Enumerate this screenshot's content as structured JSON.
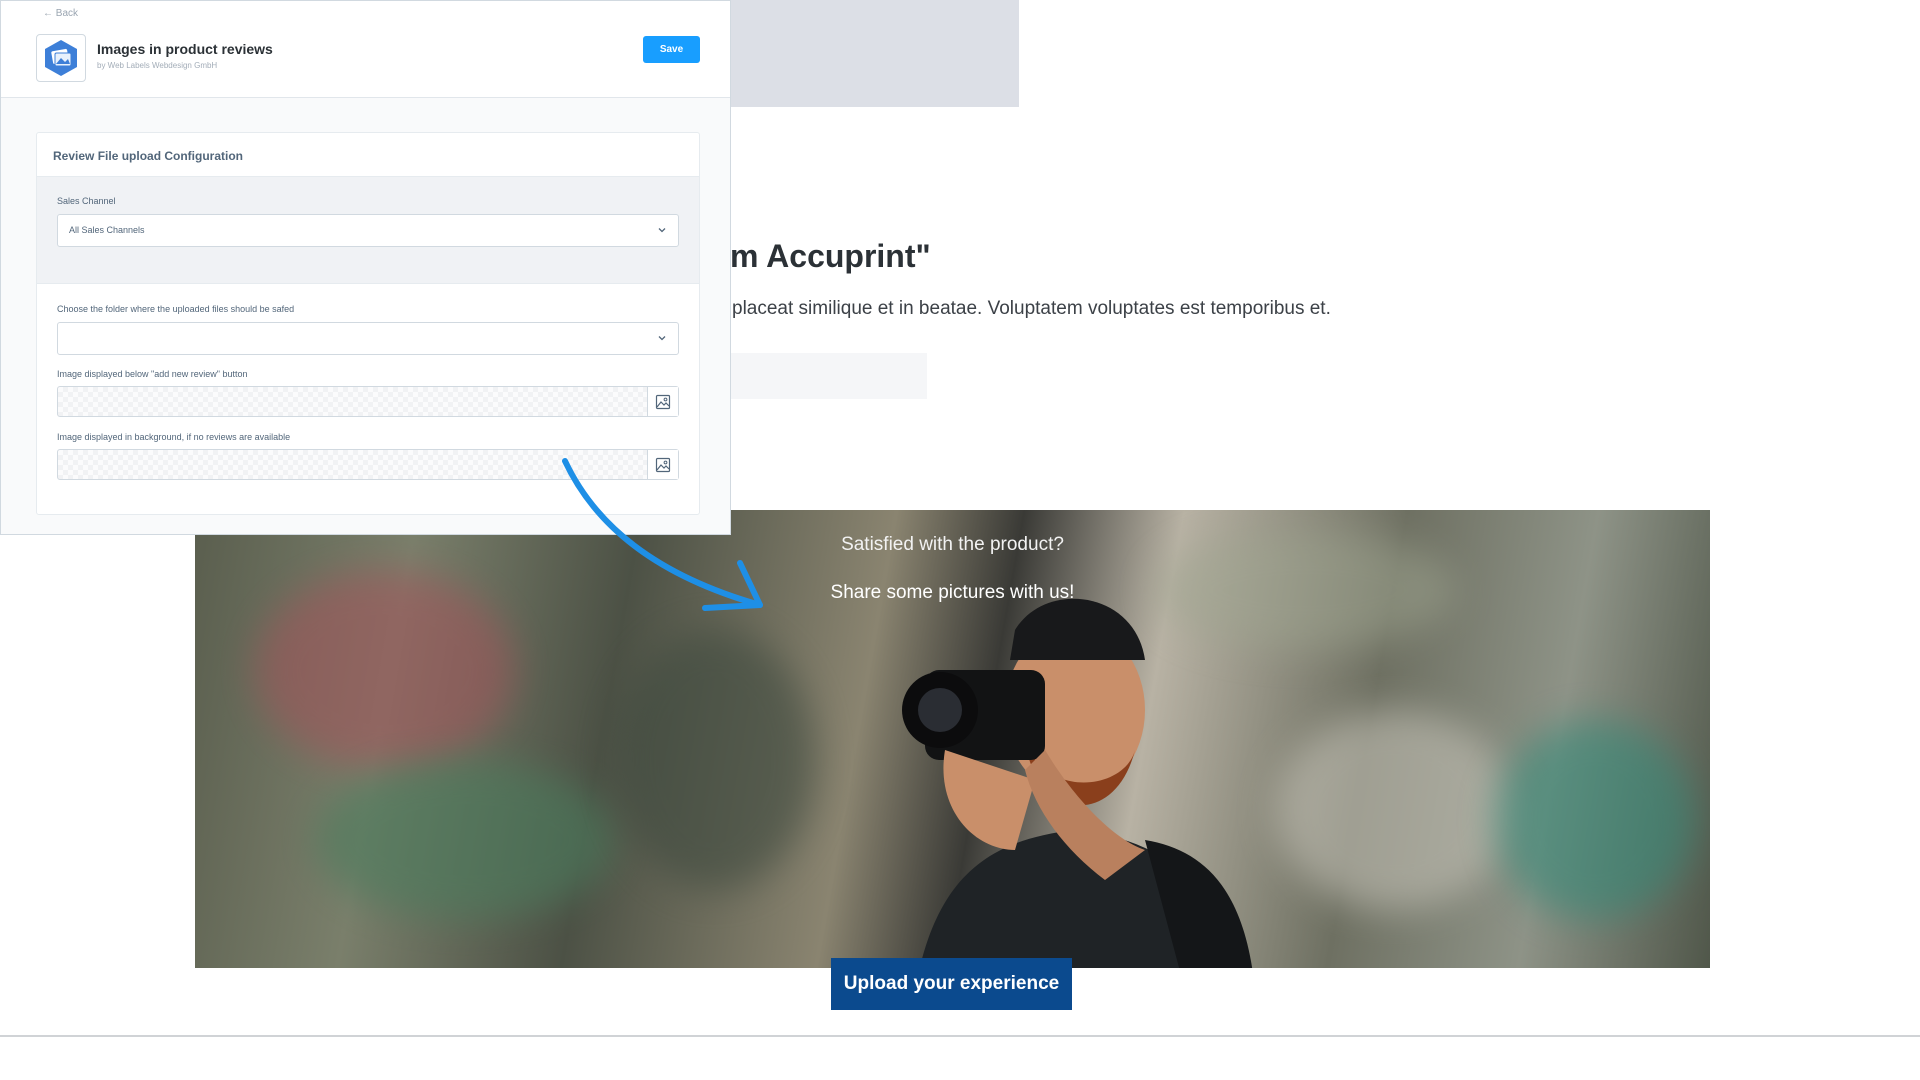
{
  "storefront": {
    "product_title": "m Accuprint\"",
    "product_description": "placeat similique et in beatae. Voluptatem voluptates est temporibus et.",
    "hero": {
      "line1": "Satisfied with the product?",
      "line2": "Share some pictures with us!",
      "upload_label": "Upload your experience"
    }
  },
  "admin": {
    "back_label": "← Back",
    "app_title": "Images in product reviews",
    "app_vendor": "by Web Labels Webdesign GmbH",
    "save_label": "Save",
    "card_title": "Review File upload Configuration",
    "sales_channel": {
      "label": "Sales Channel",
      "value": "All Sales Channels"
    },
    "folder": {
      "label": "Choose the folder where the uploaded files should be safed",
      "value": ""
    },
    "image_below_button": {
      "label": "Image displayed below \"add new review\" button"
    },
    "image_background": {
      "label": "Image displayed in background, if no reviews are available"
    }
  },
  "icons": {
    "app_logo": "images-app-icon",
    "chevron": "chevron-down-icon",
    "media": "image-icon",
    "arrow": "curved-arrow-icon"
  },
  "colors": {
    "primary": "#189eff",
    "upload_button": "#0b4a8e",
    "arrow": "#1e8fe6",
    "text_dark": "#2b3136",
    "label": "#52667a"
  }
}
